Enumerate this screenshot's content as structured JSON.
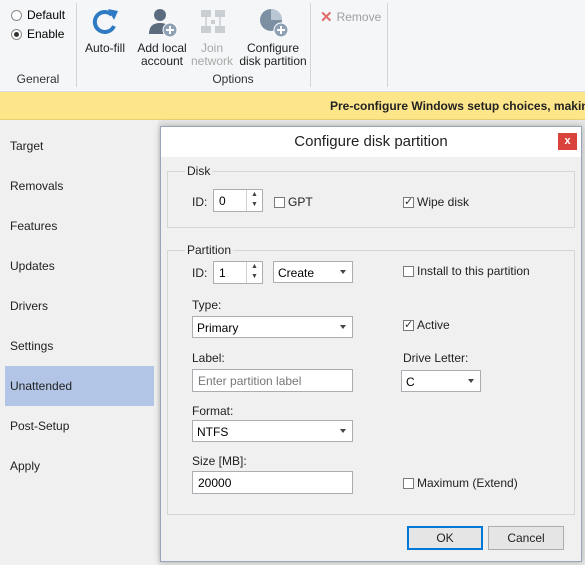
{
  "ribbon": {
    "general": {
      "label": "General",
      "default_label": "Default",
      "enable_label": "Enable",
      "selected": "Enable"
    },
    "options": {
      "label": "Options",
      "autofill": {
        "line1": "Auto-fill",
        "line2": ""
      },
      "add_local": {
        "line1": "Add local",
        "line2": "account"
      },
      "join_network": {
        "line1": "Join",
        "line2": "network"
      },
      "configure_disk": {
        "line1": "Configure",
        "line2": "disk partition"
      }
    },
    "remove_label": "Remove"
  },
  "banner": {
    "text": "Pre-configure Windows setup choices, making an"
  },
  "sidebar": {
    "items": [
      {
        "label": "Target"
      },
      {
        "label": "Removals"
      },
      {
        "label": "Features"
      },
      {
        "label": "Updates"
      },
      {
        "label": "Drivers"
      },
      {
        "label": "Settings"
      },
      {
        "label": "Unattended"
      },
      {
        "label": "Post-Setup"
      },
      {
        "label": "Apply"
      }
    ],
    "active": "Unattended"
  },
  "dialog": {
    "title": "Configure disk partition",
    "close_glyph": "x",
    "disk": {
      "legend": "Disk",
      "id_label": "ID:",
      "id_value": "0",
      "gpt_label": "GPT",
      "gpt_checked": false,
      "wipe_label": "Wipe disk",
      "wipe_checked": true
    },
    "partition": {
      "legend": "Partition",
      "id_label": "ID:",
      "id_value": "1",
      "action_value": "Create",
      "install_label": "Install to this partition",
      "install_checked": false,
      "type_label": "Type:",
      "type_value": "Primary",
      "active_label": "Active",
      "active_checked": true,
      "label_label": "Label:",
      "label_placeholder": "Enter partition label",
      "drive_letter_label": "Drive Letter:",
      "drive_letter_value": "C",
      "format_label": "Format:",
      "format_value": "NTFS",
      "size_label": "Size [MB]:",
      "size_value": "20000",
      "maximum_label": "Maximum (Extend)",
      "maximum_checked": false
    },
    "ok_label": "OK",
    "cancel_label": "Cancel"
  }
}
